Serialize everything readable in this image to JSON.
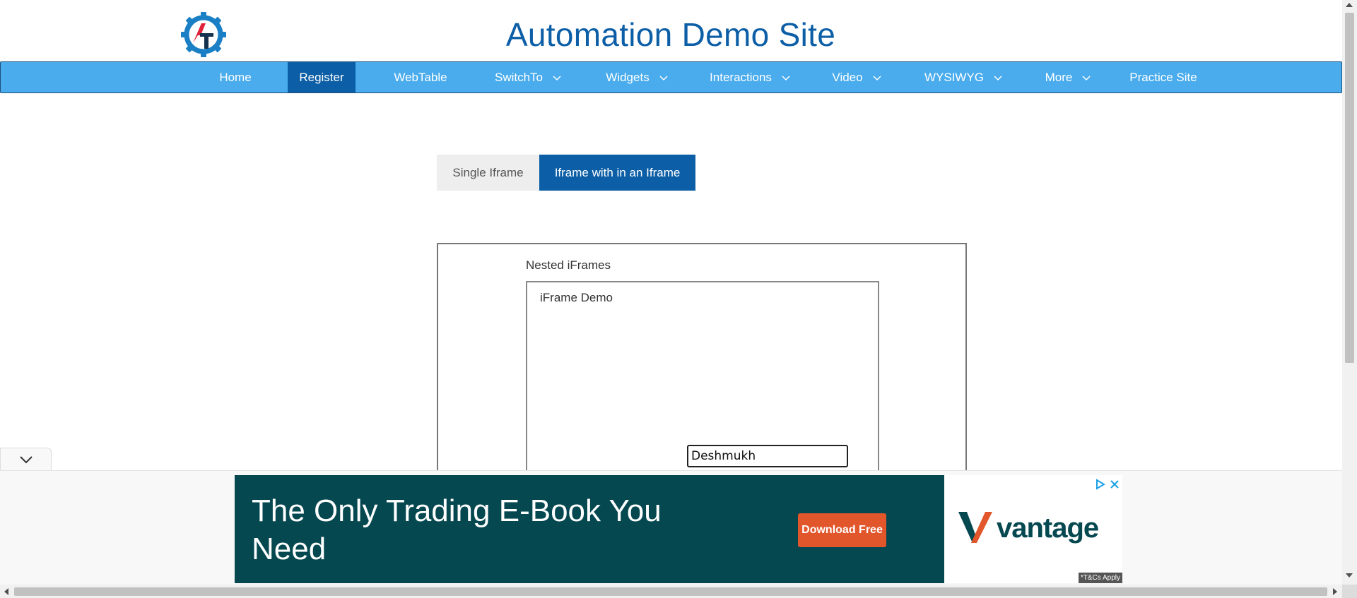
{
  "header": {
    "title": "Automation Demo Site",
    "logo_text": "AT",
    "logo_icon": "gear-logo-icon"
  },
  "nav": {
    "items": [
      {
        "label": "Home",
        "dropdown": false,
        "active": false
      },
      {
        "label": "Register",
        "dropdown": false,
        "active": true
      },
      {
        "label": "WebTable",
        "dropdown": false,
        "active": false
      },
      {
        "label": "SwitchTo",
        "dropdown": true,
        "active": false
      },
      {
        "label": "Widgets",
        "dropdown": true,
        "active": false
      },
      {
        "label": "Interactions",
        "dropdown": true,
        "active": false
      },
      {
        "label": "Video",
        "dropdown": true,
        "active": false
      },
      {
        "label": "WYSIWYG",
        "dropdown": true,
        "active": false
      },
      {
        "label": "More",
        "dropdown": true,
        "active": false
      },
      {
        "label": "Practice Site",
        "dropdown": false,
        "active": false
      }
    ],
    "bar_color": "#4aaced",
    "active_color": "#0c5ea6"
  },
  "tabs": {
    "single": "Single Iframe",
    "nested": "Iframe with in an Iframe",
    "selected": "nested"
  },
  "outer_frame": {
    "heading": "Nested iFrames"
  },
  "inner_frame": {
    "heading": "iFrame Demo",
    "input_value": "Deshmukh"
  },
  "ad": {
    "headline": "The Only Trading E-Book You Need",
    "cta": "Download Free",
    "brand": "vantage",
    "terms": "*T&Cs Apply",
    "icons": [
      "chevron-down-icon",
      "ad-choices-icon",
      "close-icon"
    ],
    "bg_color": "#054850",
    "cta_color": "#e2562b"
  }
}
